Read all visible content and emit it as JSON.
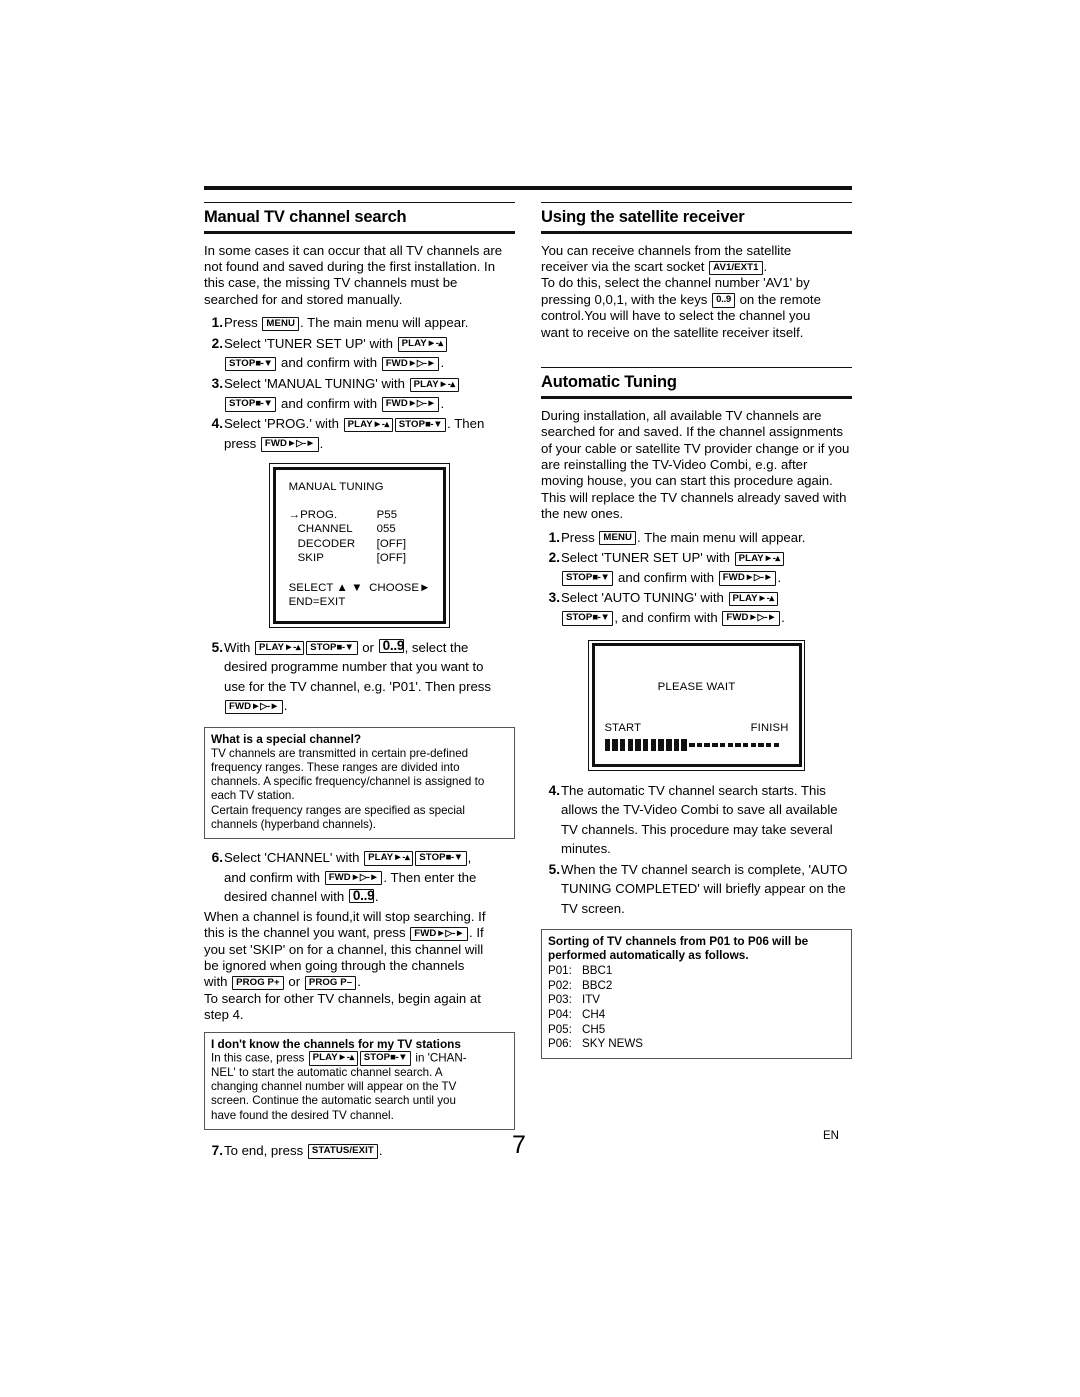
{
  "page": {
    "number": "7",
    "language": "EN"
  },
  "left": {
    "heading": "Manual TV channel search",
    "intro": "In some cases it can occur that all TV channels are not found and saved during the first installation. In this case, the missing TV channels must be searched for and stored manually.",
    "steps": [
      {
        "num": "1.",
        "parts": [
          "Press ",
          "KEY:MENU",
          ". The main menu will appear."
        ]
      },
      {
        "num": "2.",
        "parts": [
          "Select 'TUNER SET UP' with ",
          "KEY:PLAY",
          "\nKEY:STOP",
          " and confirm with ",
          "KEY:FWD",
          "."
        ]
      },
      {
        "num": "3.",
        "parts": [
          "Select 'MANUAL TUNING' with ",
          "KEY:PLAY",
          "\nKEY:STOP",
          " and confirm with ",
          "KEY:FWD",
          "."
        ]
      },
      {
        "num": "4.",
        "parts": [
          "Select 'PROG.' with ",
          "KEY:PLAY",
          "KEY:STOP",
          ". Then press ",
          "KEY:FWD",
          "."
        ]
      },
      {
        "num": "5.",
        "parts": [
          "With ",
          "KEY:PLAY",
          "KEY:STOP",
          " or ",
          "KEY:09",
          ", select the desired programme number that you want to use for the TV channel, e.g. 'P01'. Then press ",
          "KEY:FWD",
          "."
        ]
      },
      {
        "num": "6.",
        "parts": [
          "Select 'CHANNEL' with ",
          "KEY:PLAY",
          "KEY:STOP",
          ", and confirm with ",
          "KEY:FWD",
          ". Then enter the desired channel with ",
          "KEY:09",
          "."
        ]
      },
      {
        "num": "7.",
        "parts": [
          "To end, press ",
          "KEY:STATUSEXIT",
          "."
        ]
      }
    ],
    "step1_pre": "Press",
    "step1_post": ". The main menu will appear.",
    "step2_l1a": "Select 'TUNER SET UP' with",
    "step2_l2a": "and confirm with",
    "step2_l2b": ".",
    "step3_l1a": "Select 'MANUAL TUNING' with",
    "step3_l2a": "and confirm with",
    "step3_l2b": ".",
    "step4_l1a": "Select 'PROG.' with",
    "step4_l1b": ". Then",
    "step4_l2a": "press",
    "step4_l2b": ".",
    "step5_l1a": "With",
    "step5_l1b": "or",
    "step5_l1c": ", select the",
    "step5_l2": "desired programme number that you want to",
    "step5_l3": "use for the TV channel, e.g. 'P01'. Then press",
    "step5_l4": ".",
    "step6_l1a": "Select 'CHANNEL' with",
    "step6_l1b": ",",
    "step6_l2a": "and confirm with",
    "step6_l2b": ". Then enter the",
    "step6_l3a": "desired channel with",
    "step6_l3b": ".",
    "after6_l1": "When a channel is found,it will stop searching. If",
    "after6_l2a": "this is the channel you want, press",
    "after6_l2b": ". If",
    "after6_l3": "you set 'SKIP' on for a channel, this channel will",
    "after6_l4": "be ignored when going through the channels",
    "after6_l5a": "with",
    "after6_l5b": "or",
    "after6_l5c": ".",
    "after6_l6": "To search for other TV channels, begin again at",
    "after6_l7": "step 4.",
    "step7_pre": "To end, press",
    "step7_post": ".",
    "osd": {
      "title": "MANUAL TUNING",
      "rows": [
        {
          "label": "PROG.",
          "value": "P55",
          "selected": true
        },
        {
          "label": "CHANNEL",
          "value": "055",
          "selected": false
        },
        {
          "label": "DECODER",
          "value": "[OFF]",
          "selected": false
        },
        {
          "label": "SKIP",
          "value": "[OFF]",
          "selected": false
        }
      ],
      "footer_select": "SELECT",
      "footer_choose": "CHOOSE",
      "footer_end": "END=EXIT"
    },
    "callout_special": {
      "title": "What is a special channel?",
      "body": "TV channels are transmitted in certain pre-defined frequency ranges. These ranges are divided into channels. A specific frequency/channel is assigned to each TV station.",
      "body2": "Certain frequency ranges are specified as special channels (hyperband channels)."
    },
    "callout_dontknow": {
      "title": "I don't know the channels for my TV stations",
      "line1a": "In this case, press",
      "line1b": "in 'CHAN-",
      "line2": "NEL' to start the automatic channel search. A",
      "line3": "changing channel number will appear on the TV",
      "line4": "screen. Continue the automatic search until you",
      "line5": "have found the desired TV channel."
    }
  },
  "right": {
    "heading_satellite": "Using the satellite receiver",
    "sat_l1": "You can receive channels from the satellite",
    "sat_l2a": "receiver via the scart socket",
    "sat_l2b": ".",
    "sat_l3": "To do this, select the channel number 'AV1' by",
    "sat_l4a": "pressing 0,0,1, with the keys",
    "sat_l4b": "on the remote",
    "sat_l5": "control.You will have to select the channel you",
    "sat_l6": "want to receive on the satellite receiver itself.",
    "heading_auto": "Automatic Tuning",
    "auto_intro": "During installation, all available TV channels are searched for and saved. If the channel assignments of your cable or satellite TV provider change or if you are reinstalling the TV-Video Combi, e.g. after moving house, you can start this procedure again. This will replace the TV channels already saved with the new ones.",
    "astep1_pre": "Press",
    "astep1_post": ". The main menu will appear.",
    "astep2_l1": "Select 'TUNER SET UP' with",
    "astep2_l2a": "and confirm with",
    "astep2_l2b": ".",
    "astep3_l1": "Select 'AUTO TUNING' with",
    "astep3_l2a": ", and confirm with",
    "astep3_l2b": ".",
    "please_wait": {
      "title": "PLEASE WAIT",
      "start": "START",
      "finish": "FINISH",
      "filled_blocks": 11,
      "empty_dashes": 12
    },
    "astep4": "The automatic TV channel search starts. This allows the TV-Video Combi to save all available TV channels. This procedure may take several minutes.",
    "astep5": "When the TV channel search is complete, 'AUTO TUNING COMPLETED' will briefly appear on the TV screen.",
    "sorting": {
      "title": "Sorting of TV channels from P01 to P06 will be performed automatically as follows.",
      "channels": [
        {
          "prog": "P01:",
          "name": "BBC1"
        },
        {
          "prog": "P02:",
          "name": "BBC2"
        },
        {
          "prog": "P03:",
          "name": "ITV"
        },
        {
          "prog": "P04:",
          "name": "CH4"
        },
        {
          "prog": "P05:",
          "name": "CH5"
        },
        {
          "prog": "P06:",
          "name": "SKY NEWS"
        }
      ]
    }
  },
  "keys": {
    "menu": "MENU",
    "play": "PLAY",
    "play_sym": "►-▴",
    "stop": "STOP",
    "stop_sym": "■-▼",
    "fwd": "FWD",
    "fwd_sym": "►▷-►",
    "digits": "0..9",
    "status_exit": "STATUS/EXIT",
    "prog_plus": "PROG P+",
    "prog_minus": "PROG P–",
    "av1ext1": "AV1/EXT1"
  },
  "numbers": {
    "n1": "1.",
    "n2": "2.",
    "n3": "3.",
    "n4": "4.",
    "n5": "5.",
    "n6": "6.",
    "n7": "7."
  }
}
